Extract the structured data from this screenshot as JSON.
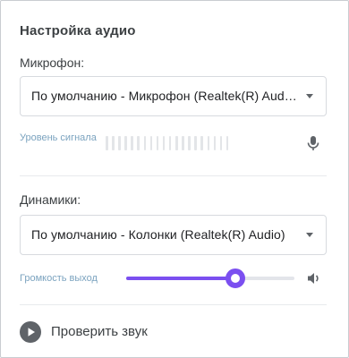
{
  "panel": {
    "title": "Настройка аудио"
  },
  "microphone": {
    "label": "Микрофон:",
    "selected": "По умолчанию - Микрофон (Realtek(R) Audio)",
    "level_label": "Уровень сигнала",
    "level_segments": 20,
    "level_active": 0
  },
  "speakers": {
    "label": "Динамики:",
    "selected": "По умолчанию - Колонки (Realtek(R) Audio)",
    "volume_label": "Громкость выход",
    "volume": 0.65
  },
  "test": {
    "label": "Проверить звук"
  },
  "colors": {
    "accent": "#7b4ff0",
    "meter_inactive": "#e3e5e8",
    "icon": "#5f6368",
    "play_bg": "#5f6368"
  },
  "icons": {
    "mic": "microphone-icon",
    "speaker": "speaker-icon",
    "play": "play-icon",
    "caret": "chevron-down-icon"
  }
}
